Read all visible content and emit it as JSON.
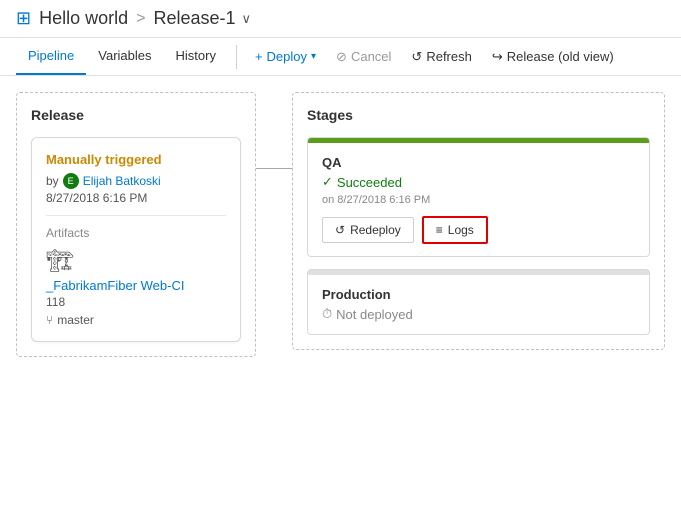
{
  "header": {
    "app_title": "Hello world",
    "separator": ">",
    "release": "Release-1",
    "chevron": "∨"
  },
  "nav": {
    "tabs": [
      {
        "label": "Pipeline",
        "active": true
      },
      {
        "label": "Variables",
        "active": false
      },
      {
        "label": "History",
        "active": false
      }
    ],
    "actions": [
      {
        "label": "Deploy",
        "icon": "+",
        "type": "deploy"
      },
      {
        "label": "Cancel",
        "icon": "⊘",
        "type": "cancel"
      },
      {
        "label": "Refresh",
        "icon": "↺",
        "type": "refresh"
      },
      {
        "label": "Release (old view)",
        "icon": "→",
        "type": "release"
      }
    ]
  },
  "release_panel": {
    "title": "Release",
    "card": {
      "triggered_title": "Manually triggered",
      "by_label": "by",
      "user": "Elijah Batkoski",
      "date": "8/27/2018 6:16 PM",
      "artifacts_label": "Artifacts",
      "artifact_name": "_FabrikamFiber Web-CI",
      "artifact_number": "118",
      "branch": "master"
    }
  },
  "stages_panel": {
    "title": "Stages",
    "stages": [
      {
        "name": "QA",
        "status": "Succeeded",
        "status_type": "success",
        "date": "on 8/27/2018 6:16 PM",
        "actions": [
          {
            "label": "Redeploy",
            "icon": "↺"
          },
          {
            "label": "Logs",
            "icon": "≡",
            "highlighted": true
          }
        ]
      },
      {
        "name": "Production",
        "status": "Not deployed",
        "status_type": "notdeployed",
        "date": "",
        "actions": []
      }
    ]
  }
}
